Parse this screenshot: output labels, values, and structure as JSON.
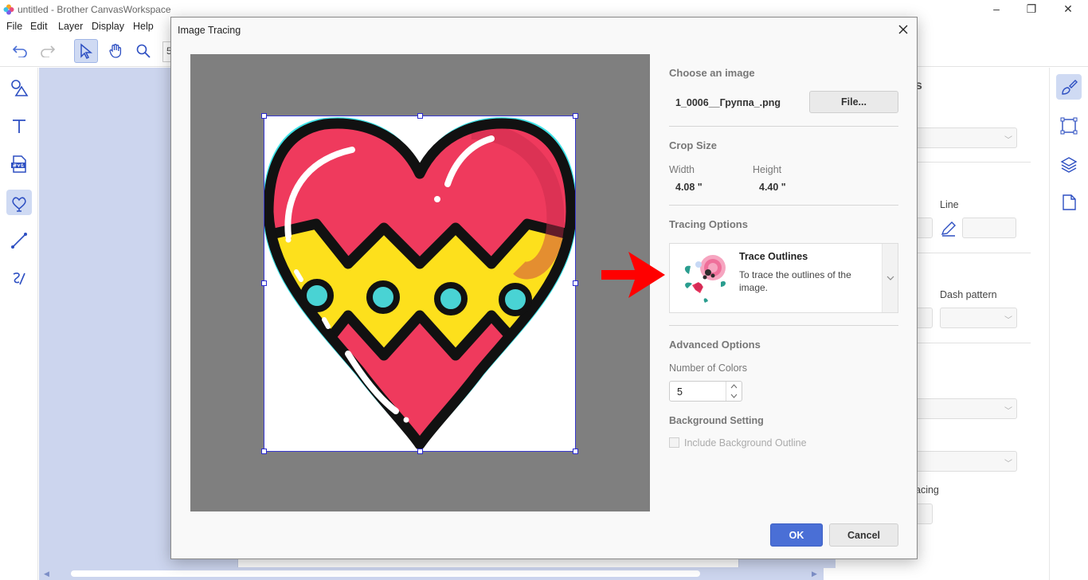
{
  "app": {
    "title": "untitled - Brother CanvasWorkspace",
    "window_controls": {
      "minimize": "–",
      "restore": "❐",
      "close": "✕"
    }
  },
  "menu": [
    "File",
    "Edit",
    "Layer",
    "Display",
    "Help"
  ],
  "toolbar": {
    "partial_field": "5"
  },
  "right_panel": {
    "partial_heading": "s",
    "line_label": "Line",
    "dash_pattern_label": "Dash pattern",
    "partial_spacing_label": "acing"
  },
  "dialog": {
    "title": "Image Tracing",
    "choose_image": {
      "heading": "Choose an image",
      "filename": "1_0006__Группа_.png",
      "file_button": "File..."
    },
    "crop_size": {
      "heading": "Crop Size",
      "width_label": "Width",
      "width_value": "4.08 \"",
      "height_label": "Height",
      "height_value": "4.40 \""
    },
    "tracing_options": {
      "heading": "Tracing Options",
      "selected_title": "Trace Outlines",
      "selected_desc": "To trace the outlines of the image."
    },
    "advanced": {
      "heading": "Advanced Options",
      "colors_label": "Number of Colors",
      "colors_value": "5",
      "background_heading": "Background Setting",
      "background_checkbox_label": "Include Background Outline",
      "background_checked": false
    },
    "ok_button": "OK",
    "cancel_button": "Cancel"
  },
  "colors": {
    "accent": "#4a6fd6",
    "canvas_bg": "#ccd5ee",
    "preview_bg": "#7f7f7f",
    "heart_red": "#ef3a5d",
    "heart_yellow": "#fde01c",
    "heart_cyan": "#49d3d4",
    "arrow_red": "#ff0000"
  }
}
